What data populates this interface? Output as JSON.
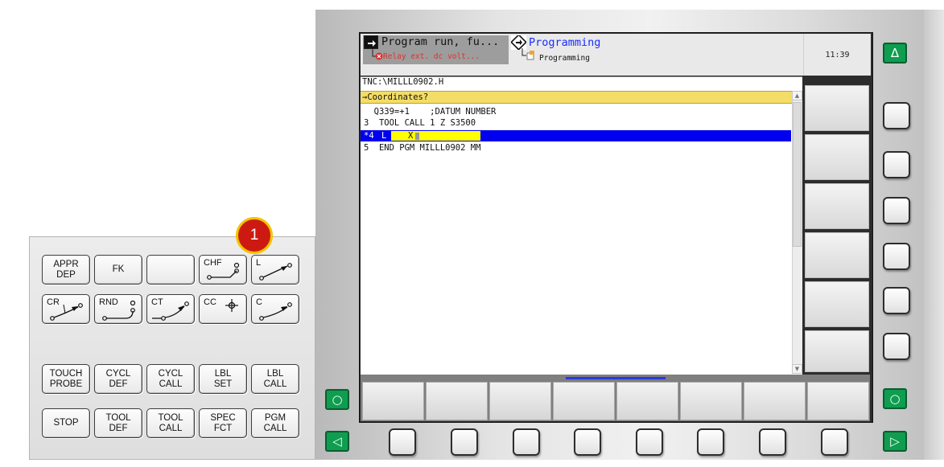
{
  "modes": {
    "machine_title": "Program run, fu...",
    "machine_status": "Relay ext. dc volt...",
    "programming_title": "Programming",
    "programming_sub": "Programming",
    "clock": "11:39"
  },
  "program": {
    "path": "TNC:\\MILLL0902.H",
    "prompt": "→Coordinates?",
    "lines": [
      "  Q339=+1    ;DATUM NUMBER",
      "3  TOOL CALL 1 Z S3500",
      "5  END PGM MILLL0902 MM"
    ],
    "active_line_no": "*4",
    "active_line_cmd": "L",
    "active_line_entry": "X"
  },
  "keypad": {
    "row1": [
      "APPR\nDEP",
      "FK",
      "",
      "CHF",
      "L"
    ],
    "row2": [
      "CR",
      "RND",
      "CT",
      "CC",
      "C"
    ],
    "row3": [
      "TOUCH\nPROBE",
      "CYCL\nDEF",
      "CYCL\nCALL",
      "LBL\nSET",
      "LBL\nCALL"
    ],
    "row4": [
      "STOP",
      "TOOL\nDEF",
      "TOOL\nCALL",
      "SPEC\nFCT",
      "PGM\nCALL"
    ]
  },
  "badge": "1",
  "buttons": {
    "up_arrow": "Δ",
    "switch_icon": "○",
    "left_arrow": "◁",
    "right_arrow": "▷"
  },
  "colors": {
    "highlight_blue": "#0000ee",
    "input_yellow": "#ffff00",
    "prompt_yellow": "#f3dd66",
    "status_red": "#e03030",
    "prog_blue": "#1a2cff",
    "green_button": "#0f9d50",
    "badge_red": "#cc1a12"
  }
}
